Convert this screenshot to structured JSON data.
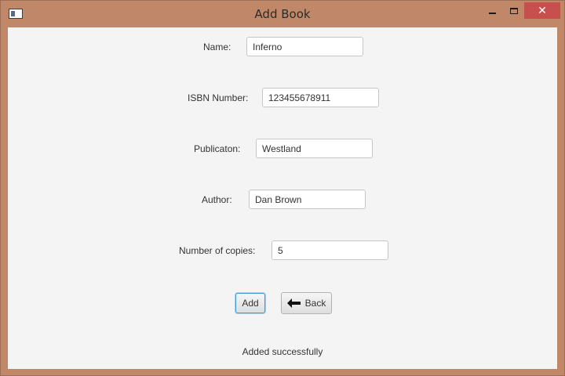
{
  "window": {
    "title": "Add Book",
    "close_glyph": "✕",
    "icons": {
      "app": "app-icon",
      "minimize": "minimize-icon",
      "maximize": "maximize-icon",
      "close": "close-icon"
    }
  },
  "form": {
    "name": {
      "label": "Name:",
      "value": "Inferno"
    },
    "isbn": {
      "label": "ISBN Number:",
      "value": "123455678911"
    },
    "publication": {
      "label": "Publicaton:",
      "value": "Westland"
    },
    "author": {
      "label": "Author:",
      "value": "Dan Brown"
    },
    "copies": {
      "label": "Number of copies:",
      "value": "5"
    }
  },
  "buttons": {
    "add_label": "Add",
    "back_label": "Back",
    "back_icon": "arrow-left-icon"
  },
  "status": {
    "message": "Added successfully"
  },
  "colors": {
    "frame": "#c08868",
    "close_button": "#c7504f",
    "client_bg": "#f4f4f4",
    "focus_border": "#3c9bd6"
  }
}
